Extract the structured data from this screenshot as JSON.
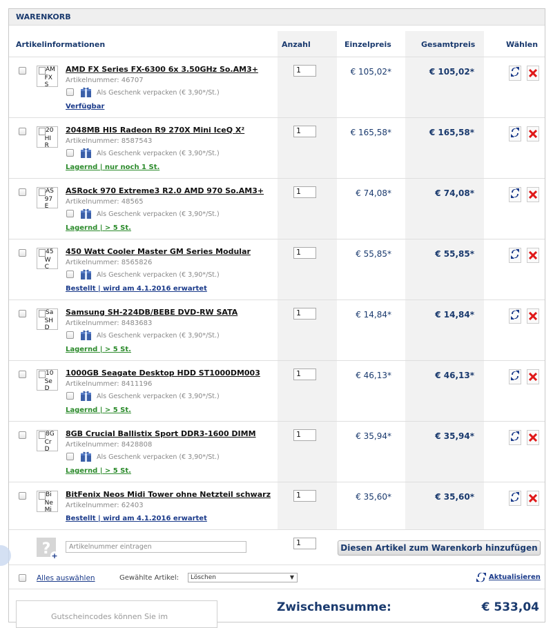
{
  "cart": {
    "title": "WARENKORB",
    "columns": {
      "info": "Artikelinformationen",
      "qty": "Anzahl",
      "unit": "Einzelpreis",
      "total": "Gesamtpreis",
      "choose": "Wählen"
    },
    "gift_label": "Als Geschenk verpacken (€ 3,90*/St.)",
    "items": [
      {
        "thumb": [
          "AM",
          "FX",
          "S"
        ],
        "title": "AMD FX Series FX-6300 6x 3.50GHz So.AM3+",
        "artnr": "Artikelnummer: 46707",
        "qty": "1",
        "unit": "€ 105,02*",
        "total": "€ 105,02*",
        "stock": "Verfügbar",
        "stock_color": "blue",
        "gift": true
      },
      {
        "thumb": [
          "20",
          "HI",
          "R"
        ],
        "title": "2048MB HIS Radeon R9 270X Mini IceQ X²",
        "artnr": "Artikelnummer: 8587543",
        "qty": "1",
        "unit": "€ 165,58*",
        "total": "€ 165,58*",
        "stock": "Lagernd | nur noch 1 St.",
        "stock_color": "green",
        "gift": true
      },
      {
        "thumb": [
          "AS",
          "97",
          "E"
        ],
        "title": "ASRock 970 Extreme3 R2.0 AMD 970 So.AM3+",
        "artnr": "Artikelnummer: 48565",
        "qty": "1",
        "unit": "€ 74,08*",
        "total": "€ 74,08*",
        "stock": "Lagernd | > 5 St.",
        "stock_color": "green",
        "gift": true
      },
      {
        "thumb": [
          "45",
          "W",
          "C"
        ],
        "title": "450 Watt Cooler Master GM Series Modular",
        "artnr": "Artikelnummer: 8565826",
        "qty": "1",
        "unit": "€ 55,85*",
        "total": "€ 55,85*",
        "stock": "Bestellt | wird am 4.1.2016 erwartet",
        "stock_color": "blue",
        "gift": true
      },
      {
        "thumb": [
          "Sa",
          "SH",
          "D"
        ],
        "title": "Samsung SH-224DB/BEBE DVD-RW SATA",
        "artnr": "Artikelnummer: 8483683",
        "qty": "1",
        "unit": "€ 14,84*",
        "total": "€ 14,84*",
        "stock": "Lagernd | > 5 St.",
        "stock_color": "green",
        "gift": true
      },
      {
        "thumb": [
          "10",
          "Se",
          "D"
        ],
        "title": "1000GB Seagate Desktop HDD ST1000DM003",
        "artnr": "Artikelnummer: 8411196",
        "qty": "1",
        "unit": "€ 46,13*",
        "total": "€ 46,13*",
        "stock": "Lagernd | > 5 St.",
        "stock_color": "green",
        "gift": true
      },
      {
        "thumb": [
          "8G",
          "Cr",
          "D"
        ],
        "title": "8GB Crucial Ballistix Sport DDR3-1600 DIMM",
        "artnr": "Artikelnummer: 8428808",
        "qty": "1",
        "unit": "€ 35,94*",
        "total": "€ 35,94*",
        "stock": "Lagernd | > 5 St.",
        "stock_color": "green",
        "gift": true
      },
      {
        "thumb": [
          "Bi",
          "Ne",
          "Mi"
        ],
        "title": "BitFenix Neos Midi Tower ohne Netzteil schwarz",
        "artnr": "Artikelnummer: 62403",
        "qty": "1",
        "unit": "€ 35,60*",
        "total": "€ 35,60*",
        "stock": "Bestellt | wird am 4.1.2016 erwartet",
        "stock_color": "blue",
        "gift": false
      }
    ],
    "add": {
      "placeholder": "Artikelnummer eintragen",
      "qty": "1",
      "button": "Diesen Artikel zum Warenkorb hinzufügen"
    },
    "selection": {
      "select_all": "Alles auswählen",
      "chosen_label": "Gewählte Artikel:",
      "action": "Löschen",
      "refresh": "Aktualisieren"
    },
    "footer": {
      "coupon_placeholder": "Gutscheincodes können Sie im",
      "subtotal_label": "Zwischensumme:",
      "subtotal_value": "€ 533,04"
    }
  }
}
